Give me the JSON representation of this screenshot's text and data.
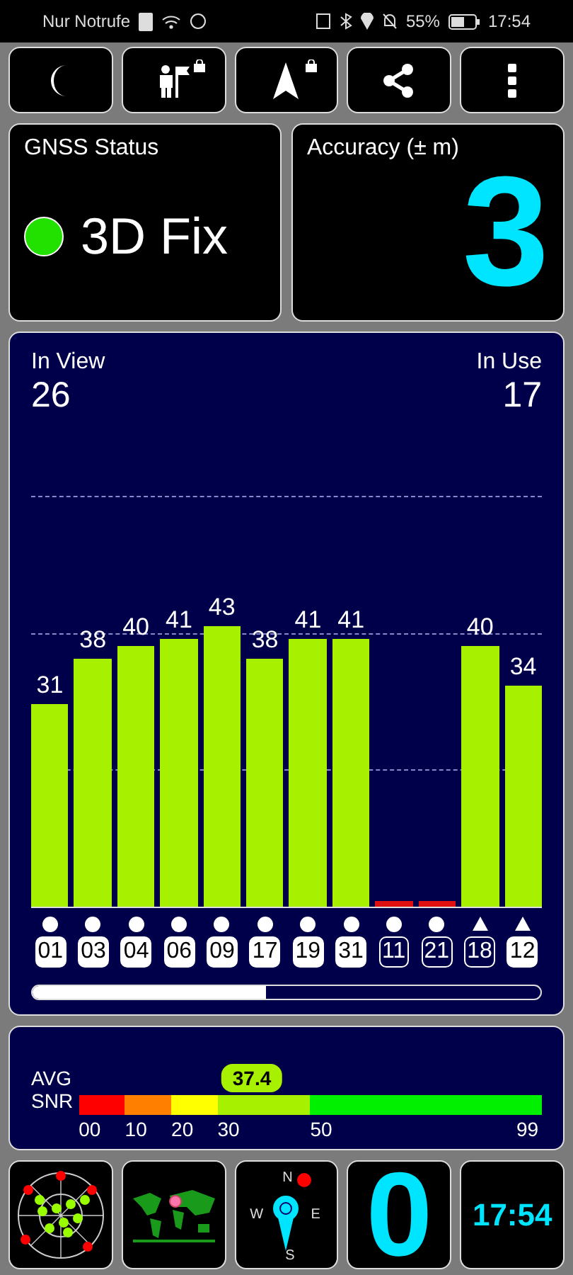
{
  "status_bar": {
    "left_text": "Nur Notrufe",
    "battery": "55%",
    "time": "17:54"
  },
  "toolbar": [
    {
      "kind": "moon",
      "locked": false
    },
    {
      "kind": "person-flag",
      "locked": true
    },
    {
      "kind": "arrow",
      "locked": true
    },
    {
      "kind": "share",
      "locked": false
    },
    {
      "kind": "more",
      "locked": false
    }
  ],
  "gnss": {
    "title": "GNSS Status",
    "status": "3D Fix",
    "color": "#22e000"
  },
  "accuracy": {
    "title": "Accuracy (± m)",
    "value": "3"
  },
  "satellites": {
    "in_view_label": "In View",
    "in_view": "26",
    "in_use_label": "In Use",
    "in_use": "17",
    "items": [
      {
        "id": "01",
        "snr": "31",
        "color": "#a6f000",
        "kind": "circle",
        "in_use": true
      },
      {
        "id": "03",
        "snr": "38",
        "color": "#a6f000",
        "kind": "circle",
        "in_use": true
      },
      {
        "id": "04",
        "snr": "40",
        "color": "#a6f000",
        "kind": "circle",
        "in_use": true
      },
      {
        "id": "06",
        "snr": "41",
        "color": "#a6f000",
        "kind": "circle",
        "in_use": true
      },
      {
        "id": "09",
        "snr": "43",
        "color": "#a6f000",
        "kind": "circle",
        "in_use": true
      },
      {
        "id": "17",
        "snr": "38",
        "color": "#a6f000",
        "kind": "circle",
        "in_use": true
      },
      {
        "id": "19",
        "snr": "41",
        "color": "#a6f000",
        "kind": "circle",
        "in_use": true
      },
      {
        "id": "31",
        "snr": "41",
        "color": "#a6f000",
        "kind": "circle",
        "in_use": true
      },
      {
        "id": "11",
        "color": "#e01010",
        "kind": "circle",
        "in_use": false
      },
      {
        "id": "21",
        "color": "#e01010",
        "kind": "circle",
        "in_use": false
      },
      {
        "id": "18",
        "snr": "40",
        "color": "#a6f000",
        "kind": "triangle",
        "in_use": false
      },
      {
        "id": "12",
        "snr": "34",
        "color": "#a6f000",
        "kind": "triangle",
        "in_use": true
      }
    ]
  },
  "snr": {
    "label_1": "AVG",
    "label_2": "SNR",
    "average": "37.4",
    "segments": [
      {
        "label": "00",
        "color": "#ff0000"
      },
      {
        "label": "10",
        "color": "#ff8000"
      },
      {
        "label": "20",
        "color": "#ffff00"
      },
      {
        "label": "30",
        "color": "#a6f000"
      },
      {
        "label": "50",
        "color": "#00f000"
      }
    ],
    "end_label": "99"
  },
  "tiles": [
    {
      "kind": "radar"
    },
    {
      "kind": "map"
    },
    {
      "kind": "compass",
      "north": "N",
      "west": "W",
      "east": "E",
      "south": "S"
    },
    {
      "kind": "number",
      "value": "0"
    },
    {
      "kind": "clock",
      "value": "17:54"
    }
  ]
}
